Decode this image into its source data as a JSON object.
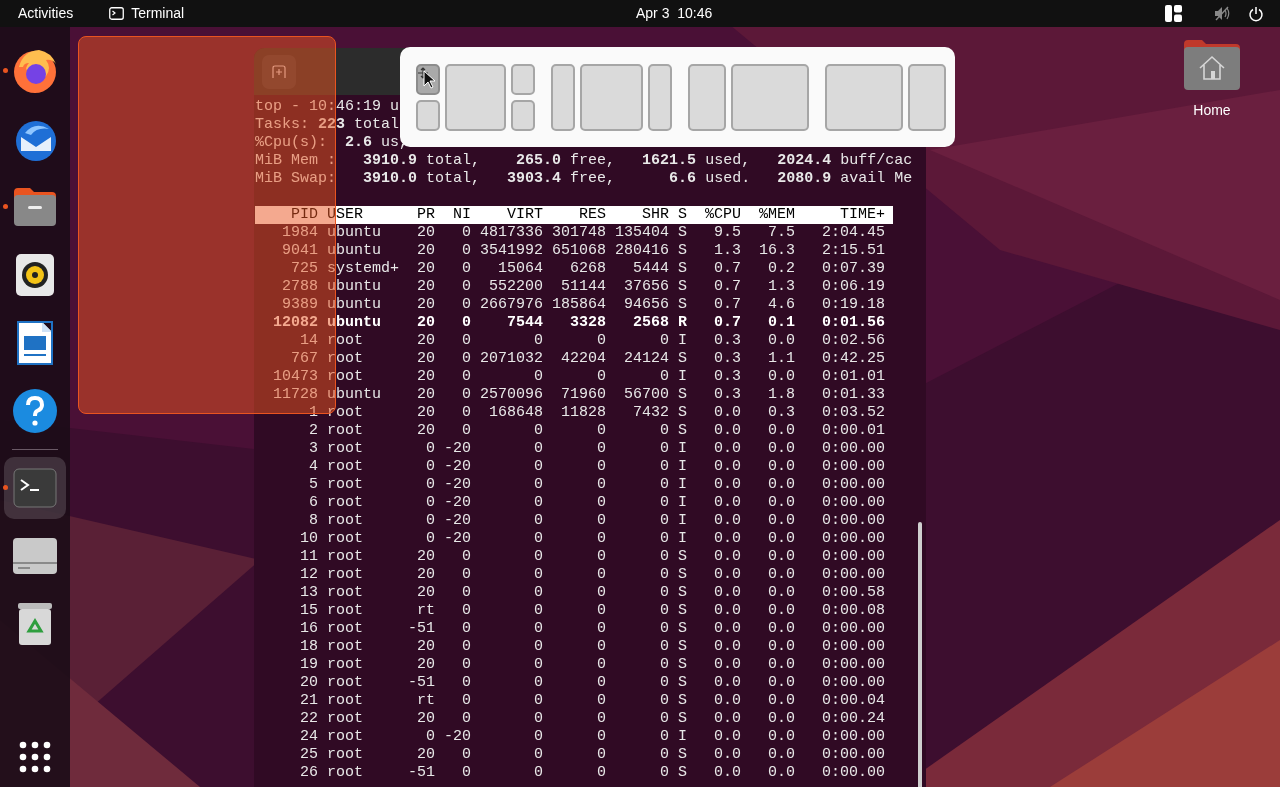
{
  "top_bar": {
    "activities": "Activities",
    "app_name": "Terminal",
    "clock": "Apr 3  10:46"
  },
  "dock": {
    "items": [
      {
        "kind": "browser",
        "running": true,
        "selected": false
      },
      {
        "kind": "mail",
        "running": false,
        "selected": false
      },
      {
        "kind": "files",
        "running": true,
        "selected": false
      },
      {
        "kind": "music",
        "running": false,
        "selected": false
      },
      {
        "kind": "writer",
        "running": false,
        "selected": false
      },
      {
        "kind": "help",
        "running": false,
        "selected": false
      },
      {
        "kind": "separator"
      },
      {
        "kind": "terminal",
        "running": true,
        "selected": true
      },
      {
        "kind": "drive",
        "running": false,
        "selected": false
      },
      {
        "kind": "trash",
        "running": false,
        "selected": false
      }
    ]
  },
  "desktop_icons": [
    {
      "label": "Home"
    }
  ],
  "terminal": {
    "summary": [
      "top - 10:46:19 u",
      "Tasks: **223** total",
      "%Cpu(s):  **2.6** us,",
      "MiB Mem :   **3910.9** total,    **265.0** free,   **1621.5** used,   **2024.4** buff/cac",
      "MiB Swap:   **3910.0** total,   **3903.4** free,      **6.6** used.   **2080.9** avail Me"
    ],
    "columns": [
      "PID",
      "USER",
      "PR",
      "NI",
      "VIRT",
      "RES",
      "SHR",
      "S",
      "%CPU",
      "%MEM",
      "TIME+"
    ],
    "rows": [
      {
        "highlighted": false,
        "cells": [
          "1984",
          "ubuntu",
          "20",
          "0",
          "4817336",
          "301748",
          "135404",
          "S",
          "9.5",
          "7.5",
          "2:04.45"
        ]
      },
      {
        "highlighted": false,
        "cells": [
          "9041",
          "ubuntu",
          "20",
          "0",
          "3541992",
          "651068",
          "280416",
          "S",
          "1.3",
          "16.3",
          "2:15.51"
        ]
      },
      {
        "highlighted": false,
        "cells": [
          "725",
          "systemd+",
          "20",
          "0",
          "15064",
          "6268",
          "5444",
          "S",
          "0.7",
          "0.2",
          "0:07.39"
        ]
      },
      {
        "highlighted": false,
        "cells": [
          "2788",
          "ubuntu",
          "20",
          "0",
          "552200",
          "51144",
          "37656",
          "S",
          "0.7",
          "1.3",
          "0:06.19"
        ]
      },
      {
        "highlighted": false,
        "cells": [
          "9389",
          "ubuntu",
          "20",
          "0",
          "2667976",
          "185864",
          "94656",
          "S",
          "0.7",
          "4.6",
          "0:19.18"
        ]
      },
      {
        "highlighted": true,
        "cells": [
          "12082",
          "ubuntu",
          "20",
          "0",
          "7544",
          "3328",
          "2568",
          "R",
          "0.7",
          "0.1",
          "0:01.56"
        ]
      },
      {
        "highlighted": false,
        "cells": [
          "14",
          "root",
          "20",
          "0",
          "0",
          "0",
          "0",
          "I",
          "0.3",
          "0.0",
          "0:02.56"
        ]
      },
      {
        "highlighted": false,
        "cells": [
          "767",
          "root",
          "20",
          "0",
          "2071032",
          "42204",
          "24124",
          "S",
          "0.3",
          "1.1",
          "0:42.25"
        ]
      },
      {
        "highlighted": false,
        "cells": [
          "10473",
          "root",
          "20",
          "0",
          "0",
          "0",
          "0",
          "I",
          "0.3",
          "0.0",
          "0:01.01"
        ]
      },
      {
        "highlighted": false,
        "cells": [
          "11728",
          "ubuntu",
          "20",
          "0",
          "2570096",
          "71960",
          "56700",
          "S",
          "0.3",
          "1.8",
          "0:01.33"
        ]
      },
      {
        "highlighted": false,
        "cells": [
          "1",
          "root",
          "20",
          "0",
          "168648",
          "11828",
          "7432",
          "S",
          "0.0",
          "0.3",
          "0:03.52"
        ]
      },
      {
        "highlighted": false,
        "cells": [
          "2",
          "root",
          "20",
          "0",
          "0",
          "0",
          "0",
          "S",
          "0.0",
          "0.0",
          "0:00.01"
        ]
      },
      {
        "highlighted": false,
        "cells": [
          "3",
          "root",
          "0",
          "-20",
          "0",
          "0",
          "0",
          "I",
          "0.0",
          "0.0",
          "0:00.00"
        ]
      },
      {
        "highlighted": false,
        "cells": [
          "4",
          "root",
          "0",
          "-20",
          "0",
          "0",
          "0",
          "I",
          "0.0",
          "0.0",
          "0:00.00"
        ]
      },
      {
        "highlighted": false,
        "cells": [
          "5",
          "root",
          "0",
          "-20",
          "0",
          "0",
          "0",
          "I",
          "0.0",
          "0.0",
          "0:00.00"
        ]
      },
      {
        "highlighted": false,
        "cells": [
          "6",
          "root",
          "0",
          "-20",
          "0",
          "0",
          "0",
          "I",
          "0.0",
          "0.0",
          "0:00.00"
        ]
      },
      {
        "highlighted": false,
        "cells": [
          "8",
          "root",
          "0",
          "-20",
          "0",
          "0",
          "0",
          "I",
          "0.0",
          "0.0",
          "0:00.00"
        ]
      },
      {
        "highlighted": false,
        "cells": [
          "10",
          "root",
          "0",
          "-20",
          "0",
          "0",
          "0",
          "I",
          "0.0",
          "0.0",
          "0:00.00"
        ]
      },
      {
        "highlighted": false,
        "cells": [
          "11",
          "root",
          "20",
          "0",
          "0",
          "0",
          "0",
          "S",
          "0.0",
          "0.0",
          "0:00.00"
        ]
      },
      {
        "highlighted": false,
        "cells": [
          "12",
          "root",
          "20",
          "0",
          "0",
          "0",
          "0",
          "S",
          "0.0",
          "0.0",
          "0:00.00"
        ]
      },
      {
        "highlighted": false,
        "cells": [
          "13",
          "root",
          "20",
          "0",
          "0",
          "0",
          "0",
          "S",
          "0.0",
          "0.0",
          "0:00.58"
        ]
      },
      {
        "highlighted": false,
        "cells": [
          "15",
          "root",
          "rt",
          "0",
          "0",
          "0",
          "0",
          "S",
          "0.0",
          "0.0",
          "0:00.08"
        ]
      },
      {
        "highlighted": false,
        "cells": [
          "16",
          "root",
          "-51",
          "0",
          "0",
          "0",
          "0",
          "S",
          "0.0",
          "0.0",
          "0:00.00"
        ]
      },
      {
        "highlighted": false,
        "cells": [
          "18",
          "root",
          "20",
          "0",
          "0",
          "0",
          "0",
          "S",
          "0.0",
          "0.0",
          "0:00.00"
        ]
      },
      {
        "highlighted": false,
        "cells": [
          "19",
          "root",
          "20",
          "0",
          "0",
          "0",
          "0",
          "S",
          "0.0",
          "0.0",
          "0:00.00"
        ]
      },
      {
        "highlighted": false,
        "cells": [
          "20",
          "root",
          "-51",
          "0",
          "0",
          "0",
          "0",
          "S",
          "0.0",
          "0.0",
          "0:00.00"
        ]
      },
      {
        "highlighted": false,
        "cells": [
          "21",
          "root",
          "rt",
          "0",
          "0",
          "0",
          "0",
          "S",
          "0.0",
          "0.0",
          "0:00.04"
        ]
      },
      {
        "highlighted": false,
        "cells": [
          "22",
          "root",
          "20",
          "0",
          "0",
          "0",
          "0",
          "S",
          "0.0",
          "0.0",
          "0:00.24"
        ]
      },
      {
        "highlighted": false,
        "cells": [
          "24",
          "root",
          "0",
          "-20",
          "0",
          "0",
          "0",
          "I",
          "0.0",
          "0.0",
          "0:00.00"
        ]
      },
      {
        "highlighted": false,
        "cells": [
          "25",
          "root",
          "20",
          "0",
          "0",
          "0",
          "0",
          "S",
          "0.0",
          "0.0",
          "0:00.00"
        ]
      },
      {
        "highlighted": false,
        "cells": [
          "26",
          "root",
          "-51",
          "0",
          "0",
          "0",
          "0",
          "S",
          "0.0",
          "0.0",
          "0:00.00"
        ]
      }
    ]
  },
  "tiling_popup": {
    "layouts": [
      {
        "kind": "center-split",
        "tiles": [
          {
            "selected": true
          },
          {
            "selected": false
          },
          {
            "selected": false
          },
          {
            "selected": false
          },
          {
            "selected": false
          }
        ]
      },
      {
        "kind": "three-columns",
        "tiles": [
          {
            "selected": false
          },
          {
            "selected": false
          },
          {
            "selected": false
          }
        ]
      },
      {
        "kind": "narrow-wide",
        "tiles": [
          {
            "selected": false
          },
          {
            "selected": false
          }
        ]
      },
      {
        "kind": "wide-narrow",
        "tiles": [
          {
            "selected": false
          },
          {
            "selected": false
          }
        ]
      }
    ]
  }
}
